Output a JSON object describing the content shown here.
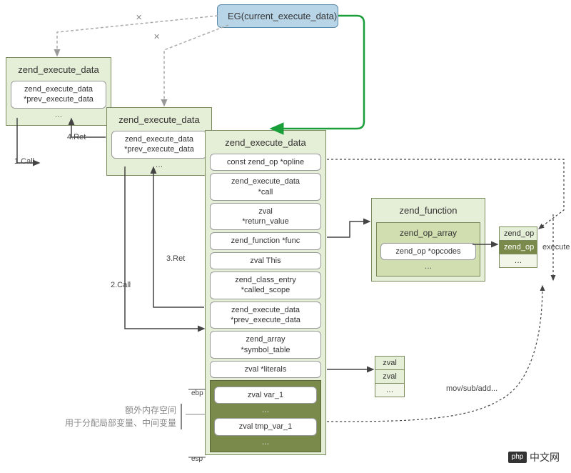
{
  "top": {
    "eg": "EG(current_execute_data)"
  },
  "ed0": {
    "title": "zend_execute_data",
    "f1": "zend_execute_data",
    "f2": "*prev_execute_data"
  },
  "ed1": {
    "title": "zend_execute_data",
    "f1": "zend_execute_data",
    "f2": "*prev_execute_data"
  },
  "ed2": {
    "title": "zend_execute_data",
    "opline": "const zend_op   *opline",
    "call1": "zend_execute_data",
    "call2": "*call",
    "ret1": "zval",
    "ret2": "*return_value",
    "func": "zend_function      *func",
    "this": "zval            This",
    "scope1": "zend_class_entry",
    "scope2": "*called_scope",
    "prev1": "zend_execute_data",
    "prev2": "*prev_execute_data",
    "sym1": "zend_array",
    "sym2": "*symbol_table",
    "lit": "zval           *literals",
    "var1": "zval  var_1",
    "tmp1": "zval  tmp_var_1"
  },
  "zf": {
    "title": "zend_function",
    "arr": "zend_op_array",
    "opcodes": "zend_op *opcodes"
  },
  "ops": {
    "c1": "zend_op",
    "c2": "zend_op"
  },
  "zvals": {
    "c1": "zval",
    "c2": "zval"
  },
  "labels": {
    "call1": "1.Call",
    "call2": "2.Call",
    "ret3": "3.Ret",
    "ret4": "4.Ret",
    "ebp": "ebp",
    "esp": "esp",
    "execute": "execute",
    "mov": "mov/sub/add...",
    "note1": "额外内存空间",
    "note2": "用于分配局部变量、中间变量"
  },
  "watermark": {
    "badge": "php",
    "text": "中文网"
  }
}
